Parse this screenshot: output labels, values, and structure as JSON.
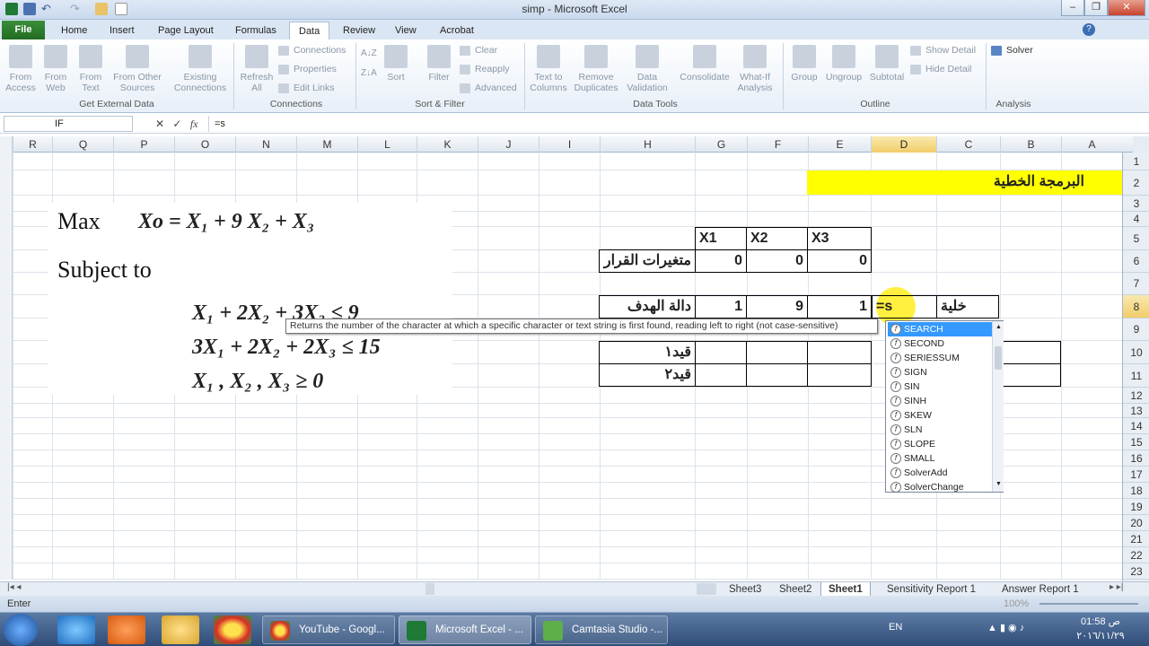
{
  "window": {
    "title": "simp - Microsoft Excel"
  },
  "tabs": [
    "File",
    "Home",
    "Insert",
    "Page Layout",
    "Formulas",
    "Data",
    "Review",
    "View",
    "Acrobat"
  ],
  "ribbon": {
    "get_external": {
      "label": "Get External Data",
      "buttons": [
        "From Access",
        "From Web",
        "From Text",
        "From Other Sources",
        "Existing Connections"
      ]
    },
    "connections": {
      "label": "Connections",
      "refresh": "Refresh All",
      "items": [
        "Connections",
        "Properties",
        "Edit Links"
      ]
    },
    "sort_filter": {
      "label": "Sort & Filter",
      "sort": "Sort",
      "filter": "Filter",
      "items": [
        "Clear",
        "Reapply",
        "Advanced"
      ]
    },
    "data_tools": {
      "label": "Data Tools",
      "buttons": [
        "Text to Columns",
        "Remove Duplicates",
        "Data Validation",
        "Consolidate",
        "What-If Analysis"
      ]
    },
    "outline": {
      "label": "Outline",
      "buttons": [
        "Group",
        "Ungroup",
        "Subtotal"
      ],
      "items": [
        "Show Detail",
        "Hide Detail"
      ]
    },
    "analysis": {
      "label": "Analysis",
      "solver": "Solver"
    }
  },
  "formula_bar": {
    "name_box": "IF",
    "formula": "=s",
    "fx": "fx"
  },
  "columns": [
    "R",
    "Q",
    "P",
    "O",
    "N",
    "M",
    "L",
    "K",
    "J",
    "I",
    "H",
    "G",
    "F",
    "E",
    "D",
    "C",
    "B",
    "A"
  ],
  "rows": [
    "1",
    "2",
    "3",
    "4",
    "5",
    "6",
    "7",
    "8",
    "9",
    "10",
    "11",
    "12",
    "13",
    "14",
    "15",
    "16",
    "17",
    "18",
    "19",
    "20",
    "21",
    "22",
    "23"
  ],
  "sheet": {
    "title": "البرمجة الخطية",
    "headers": [
      "X1",
      "X2",
      "X3"
    ],
    "decision_label": "متغيرات القرار",
    "decision_values": [
      "0",
      "0",
      "0"
    ],
    "objective_label": "دالة الهدف",
    "objective_values": [
      "1",
      "9",
      "1"
    ],
    "editing_cell": "=s",
    "solution_label": "خلية الحل",
    "constraint1": "قيد١",
    "constraint2": "قيد٢"
  },
  "equation": {
    "max": "Max",
    "objective": "Xo =  X₁  + 9 X₂ + X₃",
    "subject": "Subject to",
    "c1": "X₁ + 2X₂ + 3X₃ ≤ 9",
    "c2": "3X₁ + 2X₂ + 2X₃ ≤ 15",
    "c3": "X₁ , X₂ , X₃ ≥ 0"
  },
  "tooltip": "Returns the number of the character at which a specific character or text string is first found, reading left to right (not case-sensitive)",
  "autocomplete": [
    "SEARCH",
    "SECOND",
    "SERIESSUM",
    "SIGN",
    "SIN",
    "SINH",
    "SKEW",
    "SLN",
    "SLOPE",
    "SMALL",
    "SolverAdd",
    "SolverChange"
  ],
  "sheet_tabs": [
    "Sheet3",
    "Sheet2",
    "Sheet1",
    "Sensitivity Report 1",
    "Answer Report 1"
  ],
  "status": {
    "mode": "Enter",
    "zoom": "100%"
  },
  "taskbar": {
    "items": [
      "YouTube - Googl...",
      "Microsoft Excel - ...",
      "Camtasia Studio -..."
    ],
    "lang": "EN",
    "time": "01:58 ص",
    "date": "٢٠١٦/١١/٢٩"
  }
}
